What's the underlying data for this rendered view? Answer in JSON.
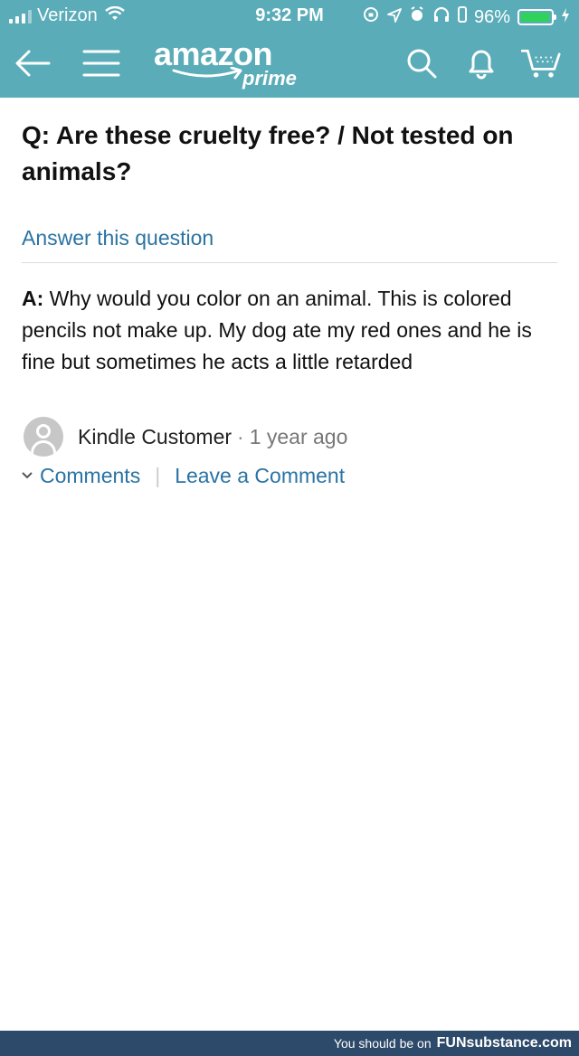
{
  "status_bar": {
    "carrier": "Verizon",
    "time": "9:32 PM",
    "battery": "96%",
    "battery_level": 0.96,
    "icons": [
      "signal-icon",
      "wifi-icon",
      "lock-rotation-icon",
      "location-icon",
      "alarm-icon",
      "headphones-icon",
      "vibrate-icon",
      "battery-icon",
      "charging-icon"
    ]
  },
  "header": {
    "brand": "amazon",
    "sub_brand": "prime",
    "icons": [
      "back-arrow-icon",
      "menu-icon",
      "search-icon",
      "bell-icon",
      "cart-icon"
    ],
    "background_color": "#5aacb8"
  },
  "question": {
    "text": "Q: Are these cruelty free? / Not tested on animals?",
    "answer_link": "Answer this question"
  },
  "answer": {
    "prefix": "A:",
    "text": "Why would you color on an animal. This is colored pencils not make up. My dog ate my red ones and he is fine but sometimes he acts a little retarded",
    "author": "Kindle Customer",
    "separator": "·",
    "time": "1 year ago",
    "comments_link": "Comments",
    "leave_comment_link": "Leave a Comment"
  },
  "footer": {
    "text": "You should be on",
    "site": "FUNsubstance.com",
    "background_color": "#2d4a6a"
  },
  "colors": {
    "link": "#2a73a3",
    "text": "#111111"
  }
}
